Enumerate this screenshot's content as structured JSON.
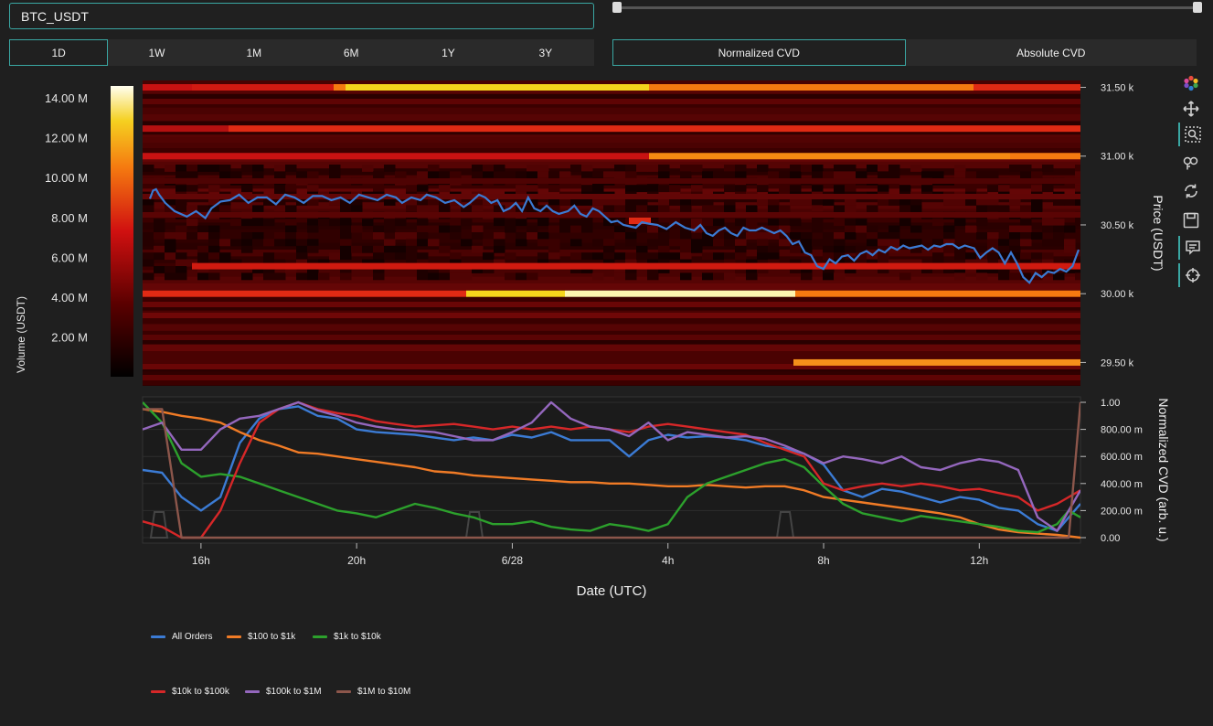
{
  "symbol_input": {
    "value": "BTC_USDT"
  },
  "range_slider": {
    "min_pct": 0,
    "max_pct": 100
  },
  "timeframes": [
    {
      "label": "1D",
      "active": true
    },
    {
      "label": "1W",
      "active": false
    },
    {
      "label": "1M",
      "active": false
    },
    {
      "label": "6M",
      "active": false
    },
    {
      "label": "1Y",
      "active": false
    },
    {
      "label": "3Y",
      "active": false
    }
  ],
  "cvd_modes": [
    {
      "label": "Normalized CVD",
      "active": true
    },
    {
      "label": "Absolute CVD",
      "active": false
    }
  ],
  "colors": {
    "accent": "#3aa7a3",
    "background": "#1f1f1f",
    "plot_background": "#1b1b1b",
    "price_line": "#3b7bd4"
  },
  "chart_data": [
    {
      "type": "heatmap",
      "ylabel": "Price (USDT)",
      "y_ticks": [
        "31.50 k",
        "31.00 k",
        "30.50 k",
        "30.00 k",
        "29.50 k"
      ],
      "colorbar": {
        "label": "Volume (USDT)",
        "ticks": [
          "14.00 M",
          "12.00 M",
          "10.00 M",
          "8.00 M",
          "6.00 M",
          "4.00 M",
          "2.00 M"
        ],
        "range": [
          0,
          14600000
        ]
      },
      "ylim": [
        29330,
        31550
      ],
      "price_series": {
        "t": [
          0,
          0.1,
          0.2,
          0.3,
          0.5,
          0.8,
          1.2,
          1.5,
          1.8,
          2,
          2.3,
          2.6,
          2.9,
          3.2,
          3.5,
          3.8,
          4.1,
          4.4,
          4.7,
          5.0,
          5.3,
          5.6,
          5.9,
          6.2,
          6.5,
          6.8,
          7.1,
          7.4,
          7.7,
          8.0,
          8.2,
          8.5,
          8.8,
          9.0,
          9.3,
          9.6,
          9.9,
          10.2,
          10.4,
          10.7,
          10.9,
          11.1,
          11.3,
          11.5,
          11.7,
          11.9,
          12.1,
          12.3,
          12.5,
          12.7,
          12.9,
          13.1,
          13.3,
          13.6,
          13.8,
          14.0,
          14.2,
          14.4,
          14.6,
          14.8,
          15.0,
          15.2,
          15.4,
          15.6,
          15.8,
          16.0,
          16.2,
          16.5,
          16.8,
          17.1,
          17.4,
          17.7,
          17.9,
          18.1,
          18.3,
          18.5,
          18.7,
          18.9,
          19.1,
          19.3,
          19.5,
          19.7,
          19.9,
          20.1,
          20.3,
          20.5,
          20.7,
          20.9,
          21.1,
          21.3,
          21.5,
          21.7,
          21.9,
          22.1,
          22.3,
          22.5,
          22.7,
          22.9,
          23.1,
          23.3,
          23.5,
          23.7,
          23.9,
          24.1,
          24.3,
          24.5,
          24.7,
          24.9,
          25.1,
          25.3,
          25.5,
          25.7,
          25.9,
          26.1,
          26.3,
          26.5,
          26.8,
          27.0,
          27.2,
          27.4,
          27.6,
          27.8,
          28.0,
          28.2,
          28.4,
          28.6,
          28.8,
          29.0,
          29.2,
          29.4,
          29.6,
          29.8,
          30.0,
          30.2
        ],
        "price": [
          30.69,
          30.75,
          30.76,
          30.72,
          30.66,
          30.6,
          30.56,
          30.6,
          30.55,
          30.62,
          30.67,
          30.68,
          30.72,
          30.66,
          30.7,
          30.7,
          30.65,
          30.72,
          30.7,
          30.66,
          30.71,
          30.71,
          30.68,
          30.7,
          30.66,
          30.72,
          30.7,
          30.68,
          30.72,
          30.7,
          30.66,
          30.7,
          30.68,
          30.72,
          30.7,
          30.66,
          30.68,
          30.63,
          30.66,
          30.72,
          30.7,
          30.66,
          30.68,
          30.6,
          30.62,
          30.66,
          30.6,
          30.7,
          30.62,
          30.6,
          30.64,
          30.6,
          30.58,
          30.6,
          30.64,
          30.58,
          30.56,
          30.62,
          30.6,
          30.56,
          30.52,
          30.53,
          30.5,
          30.49,
          30.48,
          30.52,
          30.51,
          30.5,
          30.47,
          30.52,
          30.48,
          30.46,
          30.5,
          30.44,
          30.42,
          30.46,
          30.48,
          30.44,
          30.42,
          30.48,
          30.46,
          30.46,
          30.48,
          30.46,
          30.44,
          30.46,
          30.42,
          30.36,
          30.38,
          30.3,
          30.28,
          30.2,
          30.18,
          30.25,
          30.22,
          30.27,
          30.28,
          30.24,
          30.29,
          30.31,
          30.28,
          30.32,
          30.3,
          30.34,
          30.32,
          30.35,
          30.33,
          30.34,
          30.35,
          30.32,
          30.35,
          30.34,
          30.36,
          30.36,
          30.33,
          30.35,
          30.33,
          30.26,
          30.3,
          30.33,
          30.3,
          30.22,
          30.3,
          30.22,
          30.12,
          30.08,
          30.15,
          30.12,
          30.16,
          30.15,
          30.18,
          30.16,
          30.2,
          30.32,
          30.45
        ]
      }
    },
    {
      "type": "line",
      "xlabel": "Date (UTC)",
      "ylabel": "Normalized CVD (arb. u.)",
      "x_ticks": [
        "16h",
        "20h",
        "6/28",
        "4h",
        "8h",
        "12h"
      ],
      "y_ticks": [
        "1.00",
        "800.00 m",
        "600.00 m",
        "400.00 m",
        "200.00 m",
        "0.00"
      ],
      "ylim": [
        0,
        1
      ],
      "xlim": [
        14.5,
        38.6
      ],
      "x": [
        14.5,
        15.0,
        15.5,
        16.0,
        16.5,
        17.0,
        17.5,
        18.0,
        18.5,
        19.0,
        19.5,
        20.0,
        20.5,
        21.0,
        21.5,
        22.0,
        22.5,
        23.0,
        23.5,
        24.0,
        24.5,
        25.0,
        25.5,
        26.0,
        26.5,
        27.0,
        27.5,
        28.0,
        28.5,
        29.0,
        29.5,
        30.0,
        30.5,
        31.0,
        31.5,
        32.0,
        32.5,
        33.0,
        33.5,
        34.0,
        34.5,
        35.0,
        35.5,
        36.0,
        36.5,
        37.0,
        37.5,
        38.0,
        38.3,
        38.6
      ],
      "series": [
        {
          "name": "All Orders",
          "color": "#3b7bd4",
          "values": [
            0.5,
            0.48,
            0.3,
            0.2,
            0.3,
            0.7,
            0.88,
            0.95,
            0.97,
            0.9,
            0.88,
            0.8,
            0.78,
            0.77,
            0.76,
            0.74,
            0.72,
            0.74,
            0.72,
            0.76,
            0.74,
            0.78,
            0.72,
            0.72,
            0.72,
            0.6,
            0.72,
            0.76,
            0.74,
            0.75,
            0.74,
            0.72,
            0.68,
            0.66,
            0.62,
            0.54,
            0.35,
            0.3,
            0.36,
            0.34,
            0.3,
            0.26,
            0.3,
            0.28,
            0.22,
            0.2,
            0.1,
            0.05,
            0.15,
            0.25
          ]
        },
        {
          "name": "$100 to $1k",
          "color": "#f07b26",
          "values": [
            0.95,
            0.93,
            0.9,
            0.88,
            0.85,
            0.78,
            0.72,
            0.68,
            0.63,
            0.62,
            0.6,
            0.58,
            0.56,
            0.54,
            0.52,
            0.49,
            0.48,
            0.46,
            0.45,
            0.44,
            0.43,
            0.42,
            0.41,
            0.41,
            0.4,
            0.4,
            0.39,
            0.38,
            0.38,
            0.39,
            0.38,
            0.37,
            0.38,
            0.38,
            0.35,
            0.3,
            0.28,
            0.26,
            0.24,
            0.22,
            0.2,
            0.18,
            0.15,
            0.1,
            0.06,
            0.04,
            0.03,
            0.02,
            0.01,
            0.0
          ]
        },
        {
          "name": "$1k to $10k",
          "color": "#2ca02c",
          "values": [
            1.0,
            0.85,
            0.55,
            0.45,
            0.47,
            0.45,
            0.4,
            0.35,
            0.3,
            0.25,
            0.2,
            0.18,
            0.15,
            0.2,
            0.25,
            0.22,
            0.18,
            0.15,
            0.1,
            0.1,
            0.12,
            0.08,
            0.06,
            0.05,
            0.1,
            0.08,
            0.05,
            0.1,
            0.3,
            0.4,
            0.45,
            0.5,
            0.55,
            0.58,
            0.52,
            0.38,
            0.25,
            0.18,
            0.15,
            0.12,
            0.16,
            0.14,
            0.12,
            0.1,
            0.08,
            0.05,
            0.04,
            0.1,
            0.2,
            0.15
          ]
        },
        {
          "name": "$10k to $100k",
          "color": "#d62728",
          "values": [
            0.12,
            0.08,
            0.0,
            0.0,
            0.2,
            0.55,
            0.85,
            0.95,
            1.0,
            0.95,
            0.92,
            0.9,
            0.86,
            0.84,
            0.82,
            0.83,
            0.84,
            0.82,
            0.8,
            0.82,
            0.8,
            0.82,
            0.8,
            0.82,
            0.8,
            0.78,
            0.82,
            0.84,
            0.82,
            0.8,
            0.78,
            0.76,
            0.7,
            0.65,
            0.6,
            0.4,
            0.35,
            0.38,
            0.4,
            0.38,
            0.4,
            0.38,
            0.35,
            0.36,
            0.33,
            0.3,
            0.2,
            0.25,
            0.3,
            0.35
          ]
        },
        {
          "name": "$100k to $1M",
          "color": "#9467bd",
          "values": [
            0.8,
            0.85,
            0.65,
            0.65,
            0.8,
            0.88,
            0.9,
            0.95,
            1.0,
            0.94,
            0.9,
            0.85,
            0.82,
            0.8,
            0.79,
            0.78,
            0.75,
            0.72,
            0.72,
            0.78,
            0.85,
            1.0,
            0.88,
            0.82,
            0.8,
            0.75,
            0.85,
            0.72,
            0.78,
            0.76,
            0.74,
            0.75,
            0.73,
            0.68,
            0.62,
            0.55,
            0.6,
            0.58,
            0.55,
            0.6,
            0.52,
            0.5,
            0.55,
            0.58,
            0.56,
            0.5,
            0.15,
            0.05,
            0.2,
            0.35
          ]
        },
        {
          "name": "$1M to $10M",
          "color": "#8c564b",
          "values": [
            0.95,
            0.95,
            0.0,
            0.0,
            0.0,
            0.0,
            0.0,
            0.0,
            0.0,
            0.0,
            0.0,
            0.0,
            0.0,
            0.0,
            0.0,
            0.0,
            0.0,
            0.0,
            0.0,
            0.0,
            0.0,
            0.0,
            0.0,
            0.0,
            0.0,
            0.0,
            0.0,
            0.0,
            0.0,
            0.0,
            0.0,
            0.0,
            0.0,
            0.0,
            0.0,
            0.0,
            0.0,
            0.0,
            0.0,
            0.0,
            0.0,
            0.0,
            0.0,
            0.0,
            0.0,
            0.0,
            0.0,
            0.0,
            0.0,
            1.0
          ]
        }
      ]
    }
  ],
  "toolbar": [
    {
      "name": "plotly-logo-icon"
    },
    {
      "name": "pan-icon"
    },
    {
      "name": "box-zoom-icon",
      "active": true
    },
    {
      "name": "wheel-zoom-icon"
    },
    {
      "name": "reset-icon"
    },
    {
      "name": "save-icon"
    },
    {
      "name": "hover-icon",
      "active": true
    },
    {
      "name": "crosshair-icon"
    }
  ]
}
